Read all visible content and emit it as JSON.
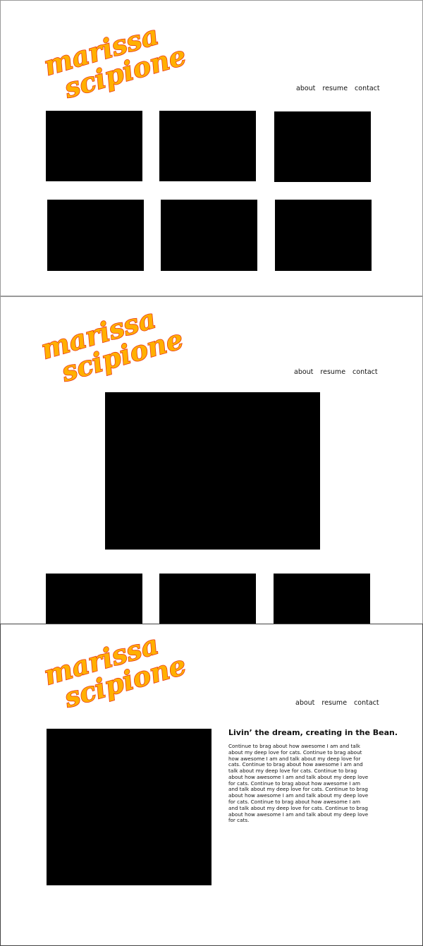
{
  "brand": {
    "line1": "marissa",
    "line2": "scipione",
    "fill_color": "#ffb000",
    "outline_color": "#ea3b1b"
  },
  "nav": {
    "about": "about",
    "resume": "resume",
    "contact": "contact"
  },
  "frames": [
    {
      "name": "portfolio-grid-view",
      "tiles": 6
    },
    {
      "name": "project-detail-view",
      "tiles": 4
    },
    {
      "name": "about-view",
      "tiles": 1
    }
  ],
  "about": {
    "heading": "Livin’ the dream, creating in the Bean.",
    "body": "Continue to brag about how awesome I am and talk about my deep love for cats. Continue to brag about how awesome I am and talk about my deep love for cats. Continue to brag about how awesome I am and talk about my deep love for cats. Continue to brag about how awesome I am and talk about my deep love for cats. Continue to brag about how awesome I am and talk about my deep love for cats. Continue to brag about how awesome I am and talk about my deep love for cats. Continue to brag about how awesome I am and talk about my deep love for cats. Continue to brag about how awesome I am and talk about my deep love for cats."
  },
  "colors": {
    "tile": "#000000",
    "background": "#ffffff",
    "text": "#111111"
  }
}
